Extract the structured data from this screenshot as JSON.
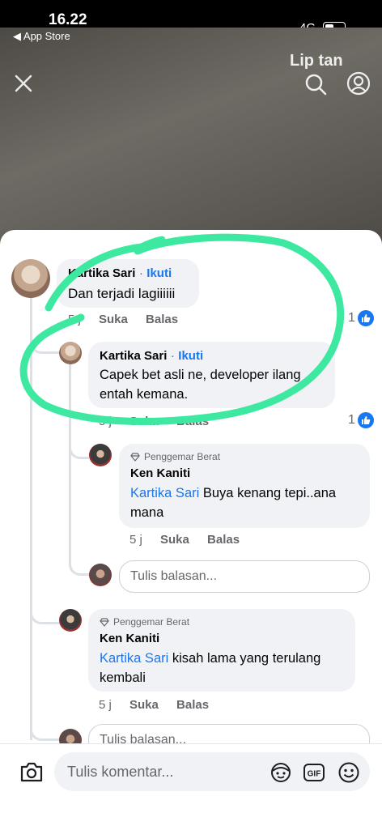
{
  "status": {
    "time": "16.22",
    "back_app": "◀ App Store",
    "network": "4G"
  },
  "watermark": "Lip  tan",
  "comments": [
    {
      "author": "Kartika Sari",
      "follow": "Ikuti",
      "text": "Dan terjadi lagiiiiii",
      "time": "5 j",
      "like": "Suka",
      "reply": "Balas",
      "likes": "1"
    },
    {
      "author": "Kartika Sari",
      "follow": "Ikuti",
      "text": "Capek bet asli ne, developer ilang entah kemana.",
      "time": "5 j",
      "like": "Suka",
      "reply": "Balas",
      "likes": "1"
    },
    {
      "badge": "Penggemar Berat",
      "author": "Ken Kaniti",
      "mention": "Kartika Sari",
      "text": "Buya kenang tepi..ana mana",
      "time": "5 j",
      "like": "Suka",
      "reply": "Balas"
    },
    {
      "badge": "Penggemar Berat",
      "author": "Ken Kaniti",
      "mention": "Kartika Sari",
      "text": "kisah lama yang terulang kembali",
      "time": "5 j",
      "like": "Suka",
      "reply": "Balas"
    }
  ],
  "reply_placeholder": "Tulis balasan...",
  "comment_placeholder": "Tulis komentar...",
  "colors": {
    "accent": "#1877f2",
    "highlight": "#3de8a0"
  },
  "icons": [
    "close-icon",
    "search-icon",
    "profile-icon",
    "like-icon",
    "diamond-icon",
    "camera-icon",
    "avatar-sticker-icon",
    "gif-icon",
    "emoji-icon"
  ]
}
